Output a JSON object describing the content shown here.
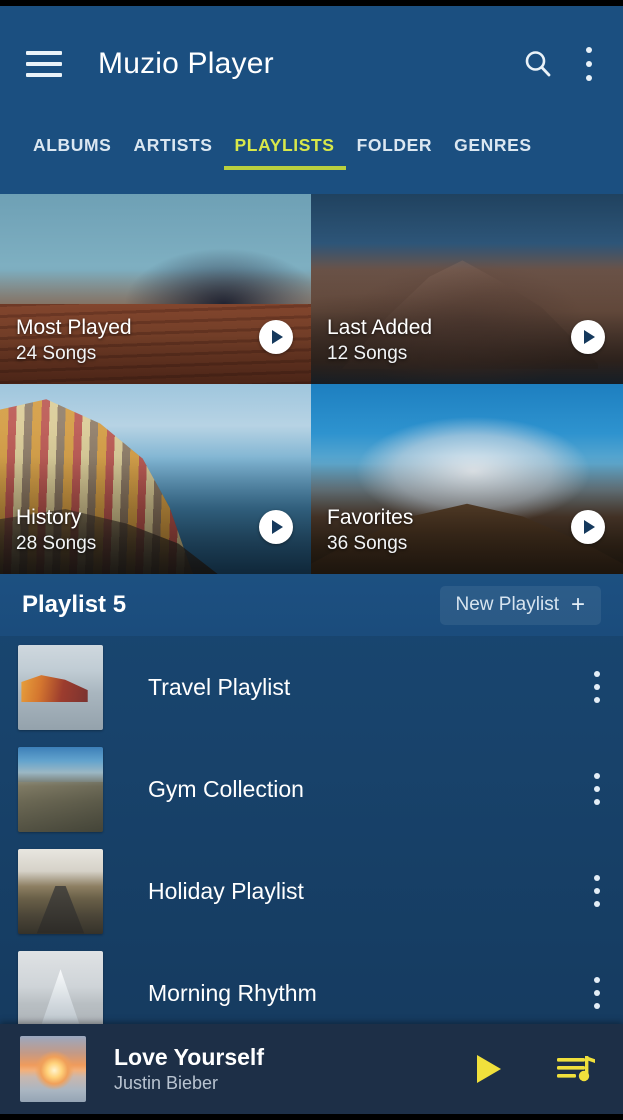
{
  "app": {
    "title": "Muzio Player",
    "menu_icon": "hamburger-menu-icon",
    "search_icon": "search-icon",
    "overflow_icon": "overflow-menu-icon",
    "accent_color": "#d8e84a",
    "appbar_color": "#1b4f80",
    "background_color": "#1a4a76"
  },
  "tabs": [
    {
      "label": "ALBUMS",
      "active": false
    },
    {
      "label": "ARTISTS",
      "active": false
    },
    {
      "label": "PLAYLISTS",
      "active": true
    },
    {
      "label": "FOLDER",
      "active": false
    },
    {
      "label": "GENRES",
      "active": false
    }
  ],
  "featured": [
    {
      "name": "Most Played",
      "count": "24 Songs",
      "art": "art-mountain1",
      "play_icon": "play-icon"
    },
    {
      "name": "Last Added",
      "count": "12 Songs",
      "art": "art-mountain2",
      "play_icon": "play-icon"
    },
    {
      "name": "History",
      "count": "28 Songs",
      "art": "art-village",
      "play_icon": "play-icon"
    },
    {
      "name": "Favorites",
      "count": "36 Songs",
      "art": "art-volcano",
      "play_icon": "play-icon"
    }
  ],
  "section": {
    "title": "Playlist 5",
    "new_playlist_label": "New Playlist",
    "new_playlist_plus": "+"
  },
  "playlists": [
    {
      "name": "Travel Playlist",
      "art": "art-santorini",
      "menu_icon": "overflow-menu-icon"
    },
    {
      "name": "Gym Collection",
      "art": "art-alps",
      "menu_icon": "overflow-menu-icon"
    },
    {
      "name": "Holiday Playlist",
      "art": "art-roadvalley",
      "menu_icon": "overflow-menu-icon"
    },
    {
      "name": "Morning Rhythm",
      "art": "art-louvre",
      "menu_icon": "overflow-menu-icon"
    }
  ],
  "now_playing": {
    "title": "Love Yourself",
    "artist": "Justin Bieber",
    "art": "art-sunset",
    "play_icon": "play-icon",
    "queue_icon": "queue-music-icon",
    "control_color": "#f0e03c",
    "bar_color": "#1d2f47"
  }
}
